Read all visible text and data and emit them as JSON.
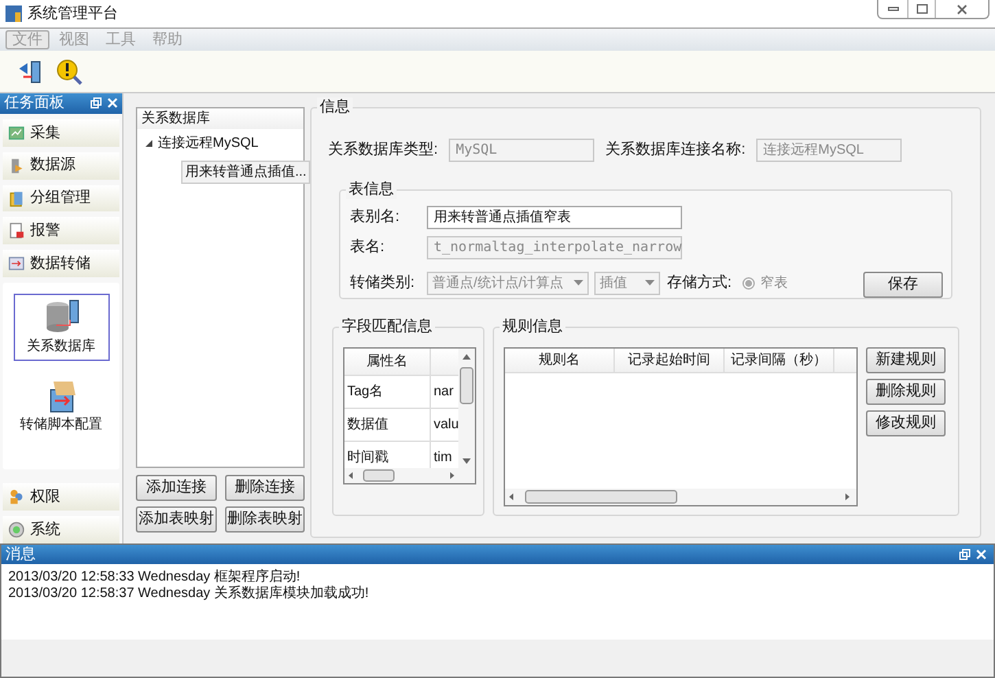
{
  "window": {
    "title": "系统管理平台"
  },
  "menu": [
    {
      "label": "文件",
      "selected": true
    },
    {
      "label": "视图",
      "selected": false
    },
    {
      "label": "工具",
      "selected": false
    },
    {
      "label": "帮助",
      "selected": false
    }
  ],
  "task_panel": {
    "title": "任务面板",
    "groups_top": [
      {
        "label": "采集"
      },
      {
        "label": "数据源"
      },
      {
        "label": "分组管理"
      },
      {
        "label": "报警"
      },
      {
        "label": "数据转储"
      }
    ],
    "sub_items": [
      {
        "label": "关系数据库",
        "selected": true
      },
      {
        "label": "转储脚本配置",
        "selected": false
      }
    ],
    "groups_bottom": [
      {
        "label": "权限"
      },
      {
        "label": "系统"
      }
    ]
  },
  "tree": {
    "title": "关系数据库",
    "nodes": [
      {
        "label": "连接远程MySQL",
        "expanded": true,
        "children": [
          {
            "label": "用来转普通点插值...",
            "selected": true
          }
        ]
      }
    ],
    "buttons": [
      "添加连接",
      "删除连接",
      "添加表映射",
      "删除表映射"
    ]
  },
  "info": {
    "title": "信息",
    "db_type": {
      "label": "关系数据库类型:",
      "value": "MySQL",
      "disabled": true
    },
    "conn_name": {
      "label": "关系数据库连接名称:",
      "value": "连接远程MySQL",
      "disabled": true
    },
    "table_info": {
      "title": "表信息",
      "alias": {
        "label": "表别名:",
        "value": "用来转普通点插值窄表",
        "disabled": false
      },
      "name": {
        "label": "表名:",
        "value": "t_normaltag_interpolate_narrow",
        "disabled": true
      },
      "dump_type": {
        "label": "转储类别:",
        "value": "普通点/统计点/计算点",
        "disabled": true
      },
      "mode": {
        "value": "插值",
        "disabled": true
      },
      "storage": {
        "label": "存储方式:",
        "option": "窄表",
        "checked": true,
        "disabled": true
      },
      "save_button": "保存"
    },
    "field_match": {
      "title": "字段匹配信息",
      "columns": [
        "属性名"
      ],
      "rows": [
        [
          "Tag名",
          "nar"
        ],
        [
          "数据值",
          "valu"
        ],
        [
          "时间戳",
          "tim"
        ]
      ]
    },
    "rules": {
      "title": "规则信息",
      "columns": [
        "规则名",
        "记录起始时间",
        "记录间隔（秒）"
      ],
      "buttons": [
        "新建规则",
        "删除规则",
        "修改规则"
      ]
    }
  },
  "messages": {
    "title": "消息",
    "lines": [
      "2013/03/20 12:58:33 Wednesday 框架程序启动!",
      "2013/03/20 12:58:37 Wednesday 关系数据库模块加载成功!"
    ]
  }
}
